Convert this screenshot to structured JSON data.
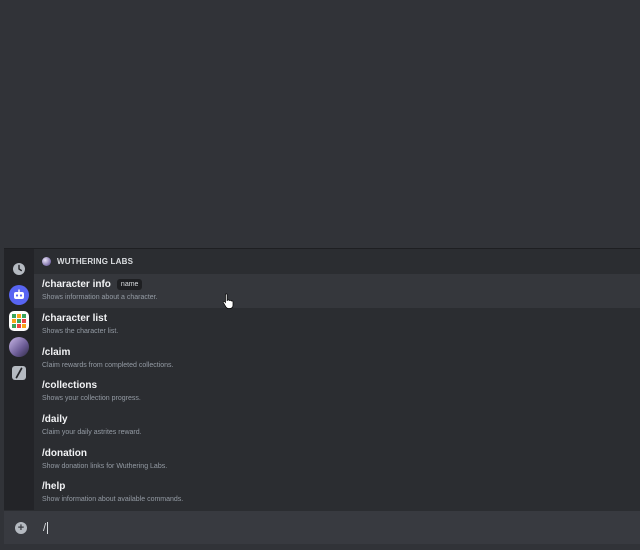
{
  "popup": {
    "app_name": "WUTHERING LABS",
    "rail": [
      {
        "name": "recent-clock-icon"
      },
      {
        "name": "bot-app-icon"
      },
      {
        "name": "grid-app-icon"
      },
      {
        "name": "wuthering-labs-app-icon"
      },
      {
        "name": "slash-commands-icon"
      }
    ],
    "commands": [
      {
        "name": "/character info",
        "option": "name",
        "desc": "Shows information about a character."
      },
      {
        "name": "/character list",
        "desc": "Shows the character list."
      },
      {
        "name": "/claim",
        "desc": "Claim rewards from completed collections."
      },
      {
        "name": "/collections",
        "desc": "Shows your collection progress."
      },
      {
        "name": "/daily",
        "desc": "Claim your daily astrites reward."
      },
      {
        "name": "/donation",
        "desc": "Show donation links for Wuthering Labs."
      },
      {
        "name": "/help",
        "desc": "Show information about available commands."
      }
    ]
  },
  "composer": {
    "value": "/"
  },
  "colors": {
    "background": "#313338",
    "popup": "#2b2d31",
    "active_row": "#35373c",
    "accent": "#5865f2"
  }
}
